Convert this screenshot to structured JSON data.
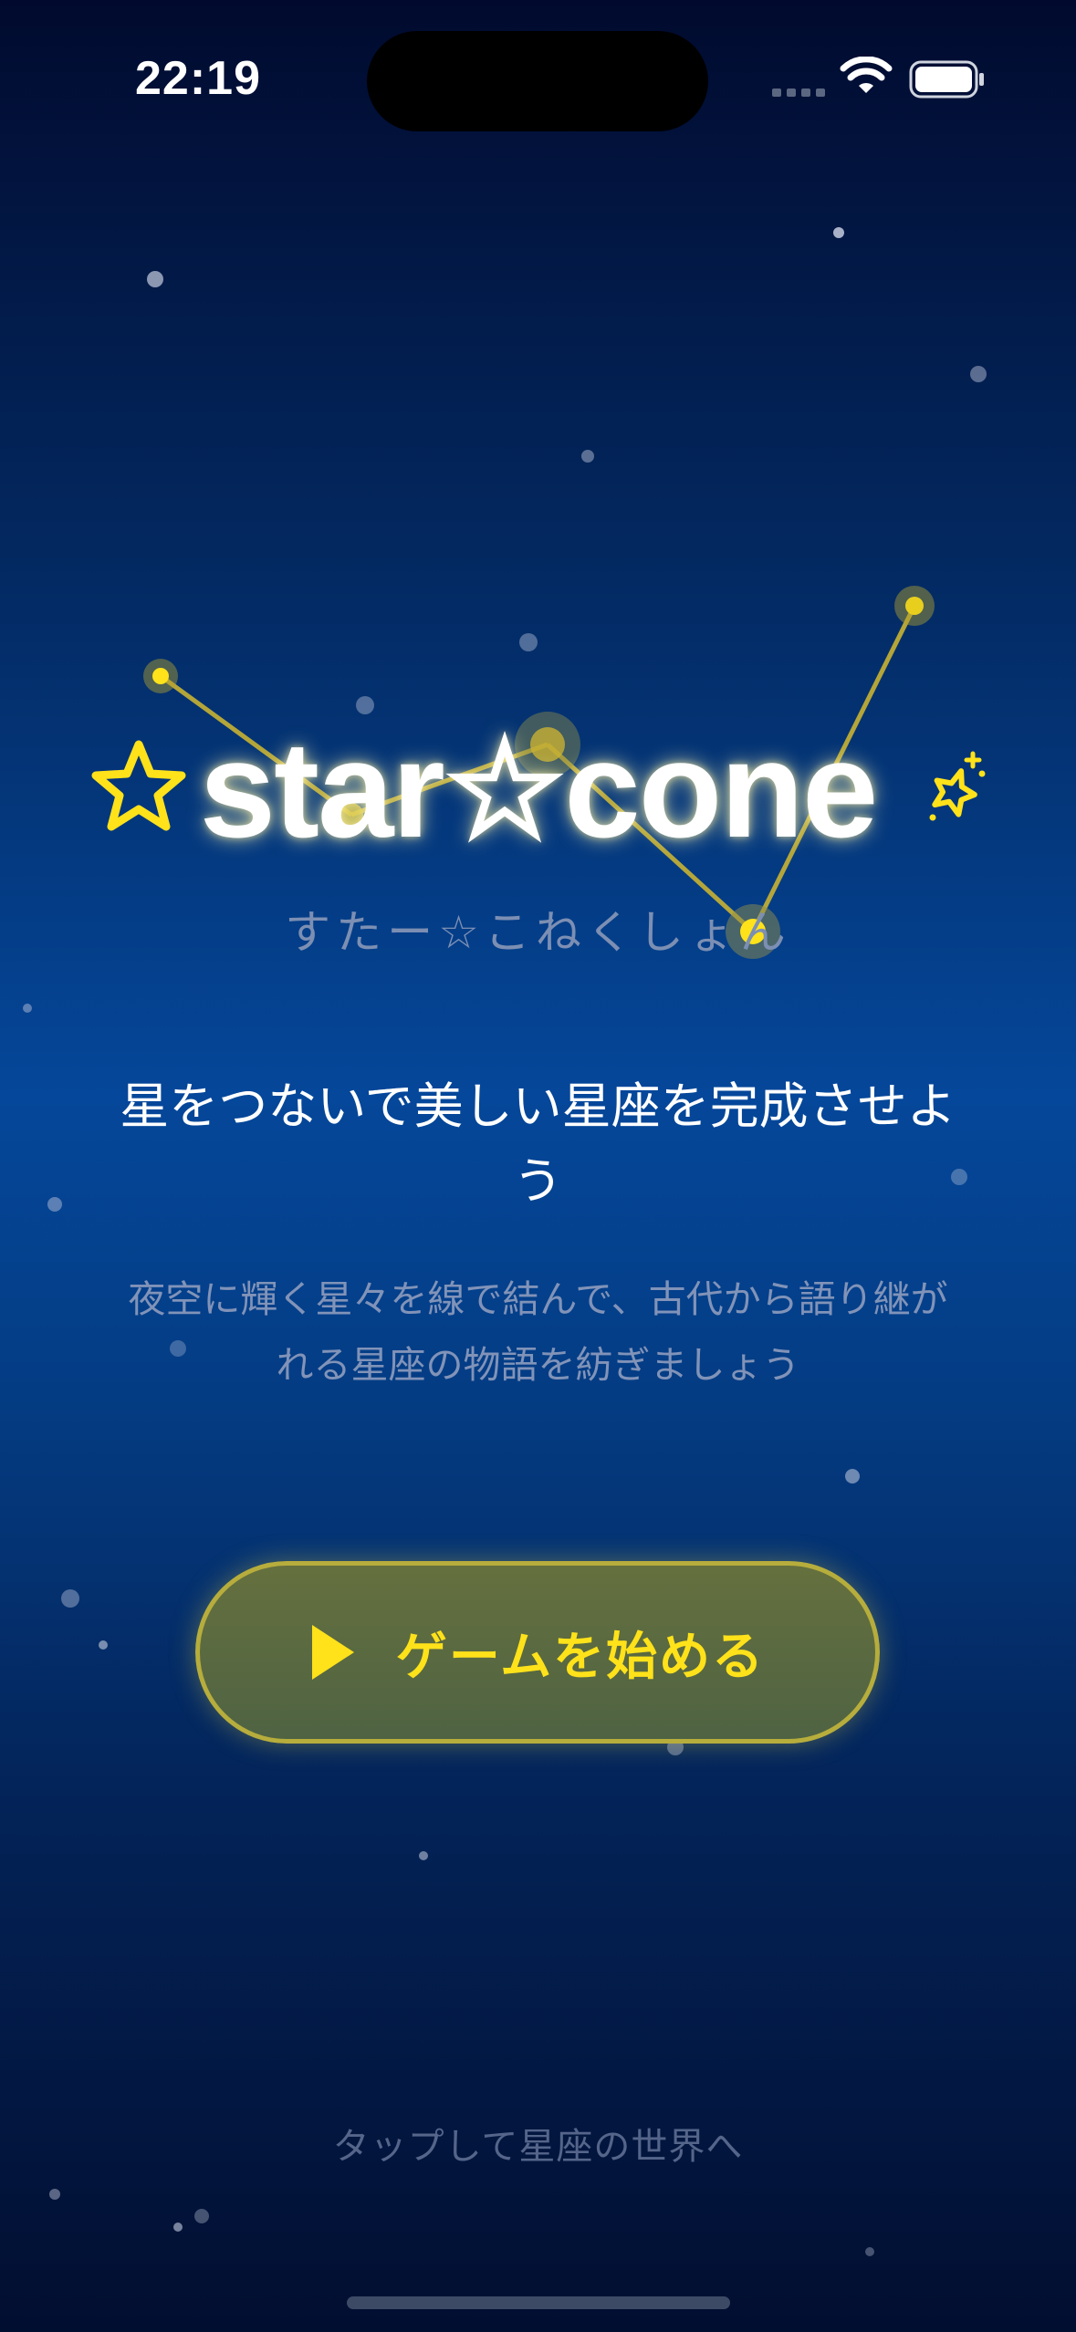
{
  "status_bar": {
    "time": "22:19"
  },
  "logo": {
    "title": "star☆cone",
    "subtitle": "すたー☆こねくしょん"
  },
  "tagline": "星をつないで美しい星座を完成させよう",
  "description": "夜空に輝く星々を線で結んで、古代から語り継がれる星座の物語を紡ぎましょう",
  "start_button": {
    "label": "ゲームを始める",
    "icon": "play-icon"
  },
  "hint": "タップして星座の世界へ",
  "colors": {
    "accent_yellow": "#ffe21a",
    "constellation_line": "#c8b233",
    "button_border": "#b7ad3c",
    "bg_top": "#010a2e",
    "bg_mid": "#05479a",
    "bg_bottom": "#020e30"
  },
  "icons": [
    "star-outline-icon",
    "sparkle-icon",
    "play-icon",
    "wifi-icon",
    "battery-icon",
    "cellular-signal-icon"
  ]
}
